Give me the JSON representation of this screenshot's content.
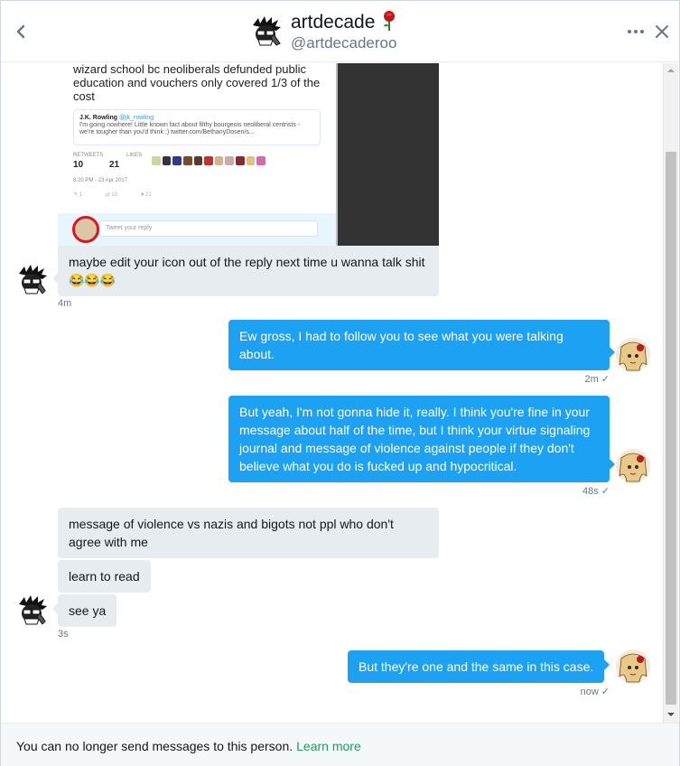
{
  "header": {
    "name": "artdecade",
    "handle": "@artdecaderoo"
  },
  "icons": {
    "back": "chevron-left-icon",
    "more": "more-horizontal-icon",
    "close": "close-icon",
    "rose": "rose-emoji"
  },
  "colors": {
    "outgoing_bubble": "#1da1f2",
    "incoming_bubble": "#e6ecf0",
    "link": "#19a05a"
  },
  "screenshot": {
    "tweet_text": "wizard school bc neoliberals defunded public education and vouchers only covered 1/3 of the cost",
    "quoted_author": "J.K. Rowling",
    "quoted_handle": "@jk_rowling",
    "quoted_text": "I'm going nowhere! Little known fact about filthy bourgeois neoliberal centrists - we're tougher than you'd think ;) twitter.com/BethanyDosen/s...",
    "retweets_label": "RETWEETS",
    "likes_label": "LIKES",
    "retweets": "10",
    "likes": "21",
    "date": "8:20 PM - 23 Apr 2017",
    "action_reply": "1",
    "action_rt": "10",
    "action_like": "21",
    "reply_placeholder": "Tweet your reply"
  },
  "messages": {
    "m1": {
      "text": "maybe edit your icon out of the reply next time u wanna talk shit 😂😂😂",
      "time": "4m"
    },
    "m2": {
      "text": "Ew gross, I had to follow you to see what you were talking about.",
      "time": "2m"
    },
    "m3": {
      "text": "But yeah, I'm not gonna hide it, really. I think you're fine in your message about half of the time, but I think your virtue signaling journal and message of violence against people if they don't believe what you do is fucked up and hypocritical.",
      "time": "48s"
    },
    "m4": {
      "text": "message of violence vs nazis and bigots not ppl who don't agree with me"
    },
    "m5": {
      "text": "learn to read"
    },
    "m6": {
      "text": "see ya",
      "time": "3s"
    },
    "m7": {
      "text": "But they're one and the same in this case.",
      "time": "now"
    }
  },
  "read_mark": "✓",
  "footer": {
    "text": "You can no longer send messages to this person.",
    "link": "Learn more"
  }
}
